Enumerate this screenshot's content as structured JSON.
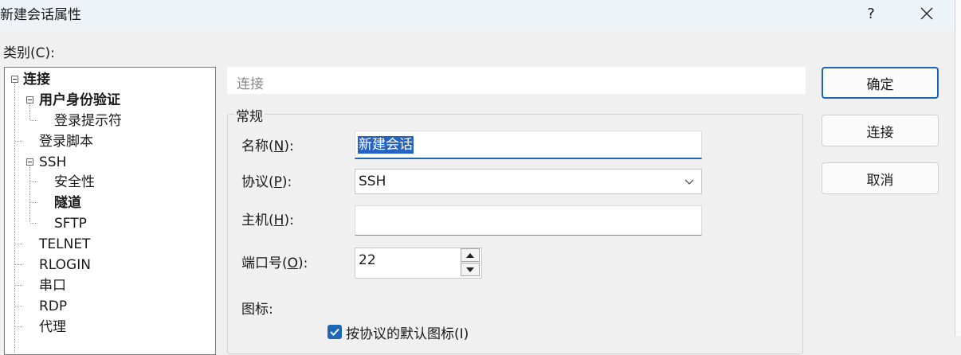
{
  "window": {
    "title": "新建会话属性",
    "help_label": "?",
    "close_icon": "close-icon"
  },
  "category_label": "类别(C):",
  "tree": {
    "items": [
      {
        "label": "连接"
      },
      {
        "label": "用户身份验证"
      },
      {
        "label": "登录提示符"
      },
      {
        "label": "登录脚本"
      },
      {
        "label": "SSH"
      },
      {
        "label": "安全性"
      },
      {
        "label": "隧道"
      },
      {
        "label": "SFTP"
      },
      {
        "label": "TELNET"
      },
      {
        "label": "RLOGIN"
      },
      {
        "label": "串口"
      },
      {
        "label": "RDP"
      },
      {
        "label": "代理"
      }
    ]
  },
  "section": {
    "title": "连接"
  },
  "general": {
    "group_label": "常规",
    "name_label": {
      "pre": "名称(",
      "key": "N",
      "post": "):"
    },
    "name_value": "新建会话",
    "protocol_label": {
      "pre": "协议(",
      "key": "P",
      "post": "):"
    },
    "protocol_value": "SSH",
    "host_label": {
      "pre": "主机(",
      "key": "H",
      "post": "):"
    },
    "host_value": "",
    "port_label": {
      "pre": "端口号(",
      "key": "O",
      "post": "):"
    },
    "port_value": "22",
    "icon_label": "图标:",
    "default_icon_checkbox": {
      "label": "按协议的默认图标(I)",
      "checked": true
    }
  },
  "buttons": {
    "ok": "确定",
    "connect": "连接",
    "cancel": "取消"
  },
  "colors": {
    "accent": "#1f66b5",
    "selection": "#2463c2"
  }
}
